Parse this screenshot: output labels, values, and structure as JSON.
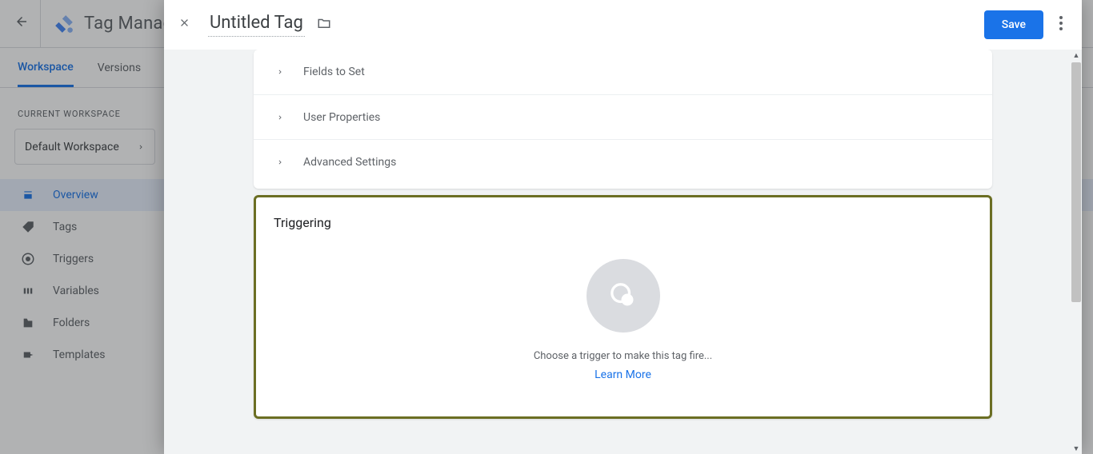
{
  "header": {
    "app_title": "Tag Manager"
  },
  "tabs": {
    "workspace": "Workspace",
    "versions": "Versions"
  },
  "workspace": {
    "label": "CURRENT WORKSPACE",
    "current": "Default Workspace"
  },
  "nav": {
    "overview": "Overview",
    "tags": "Tags",
    "triggers": "Triggers",
    "variables": "Variables",
    "folders": "Folders",
    "templates": "Templates"
  },
  "panel": {
    "tag_name": "Untitled Tag",
    "save": "Save",
    "sections": {
      "fields": "Fields to Set",
      "user_props": "User Properties",
      "advanced": "Advanced Settings"
    },
    "triggering": {
      "title": "Triggering",
      "hint": "Choose a trigger to make this tag fire...",
      "learn_more": "Learn More"
    }
  }
}
